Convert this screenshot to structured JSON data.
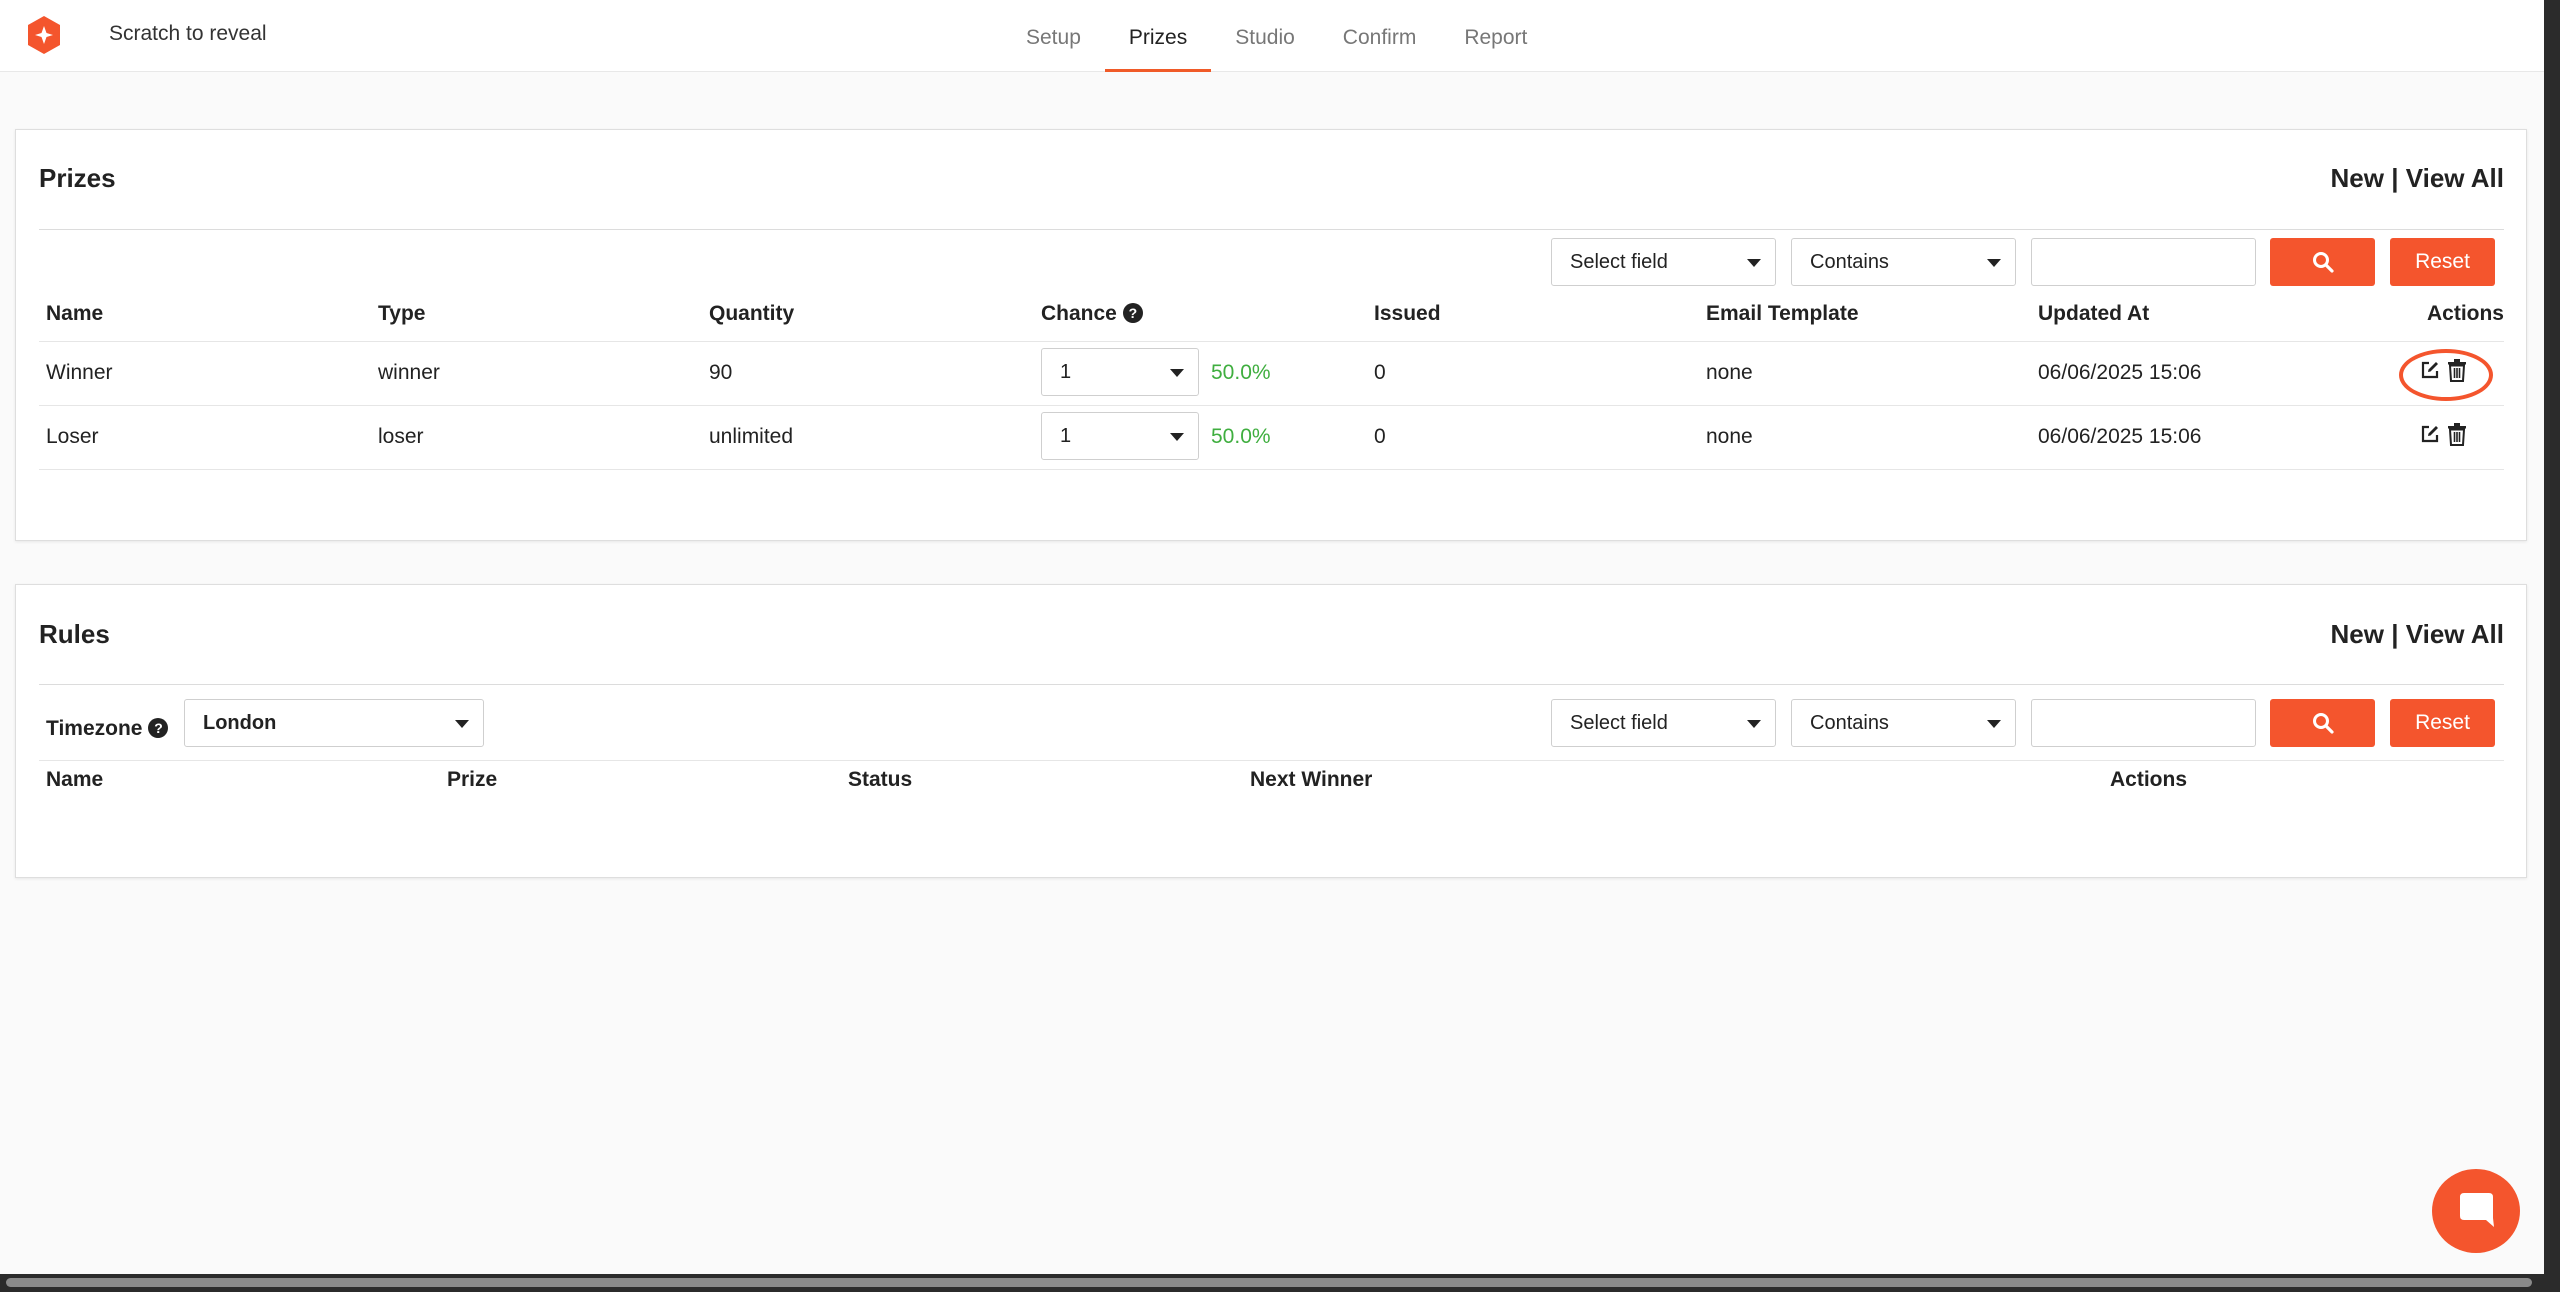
{
  "app": {
    "title": "Scratch to reveal",
    "logo_icon": "sparkle-logo-icon",
    "accent": "#f4552d"
  },
  "nav": {
    "tabs": [
      "Setup",
      "Prizes",
      "Studio",
      "Confirm",
      "Report"
    ],
    "active": "Prizes"
  },
  "prizes": {
    "title": "Prizes",
    "link_new": "New",
    "link_separator": "|",
    "link_view_all": "View All",
    "filter": {
      "field_placeholder": "Select field",
      "operator": "Contains",
      "search_value": "",
      "reset_label": "Reset"
    },
    "columns": [
      "Name",
      "Type",
      "Quantity",
      "Chance",
      "Issued",
      "Email Template",
      "Updated At",
      "Actions"
    ],
    "rows": [
      {
        "name": "Winner",
        "type": "winner",
        "quantity": "90",
        "chance": "1",
        "percent": "50.0%",
        "issued": "0",
        "email_template": "none",
        "updated_at": "06/06/2025 15:06"
      },
      {
        "name": "Loser",
        "type": "loser",
        "quantity": "unlimited",
        "chance": "1",
        "percent": "50.0%",
        "issued": "0",
        "email_template": "none",
        "updated_at": "06/06/2025 15:06"
      }
    ],
    "percent_color": "#3fae3f"
  },
  "rules": {
    "title": "Rules",
    "link_new": "New",
    "link_separator": "|",
    "link_view_all": "View All",
    "timezone_label": "Timezone",
    "timezone_value": "London",
    "filter": {
      "field_placeholder": "Select field",
      "operator": "Contains",
      "search_value": "",
      "reset_label": "Reset"
    },
    "columns": [
      "Name",
      "Prize",
      "Status",
      "Next Winner",
      "Actions"
    ]
  },
  "help_glyph": "?"
}
